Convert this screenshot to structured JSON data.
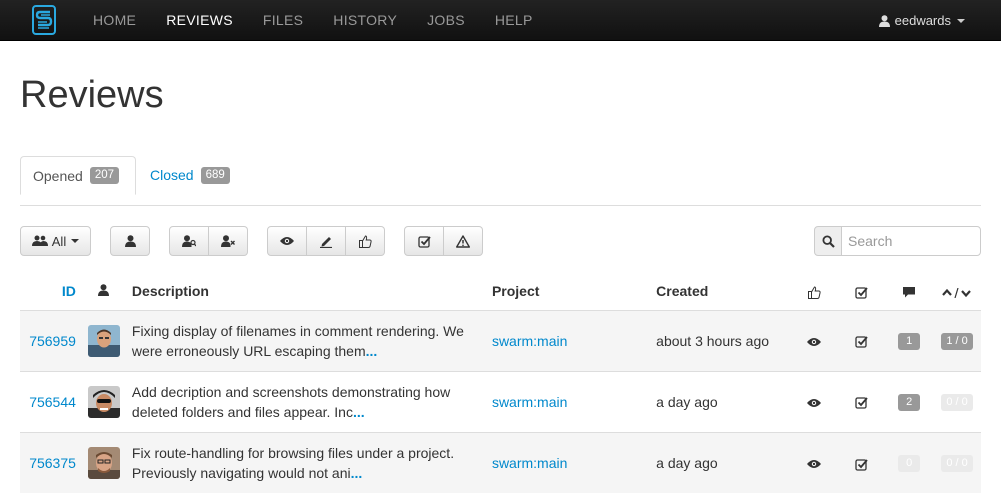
{
  "nav": {
    "logo": "swarm-logo-icon",
    "items": [
      {
        "label": "HOME",
        "active": false
      },
      {
        "label": "REVIEWS",
        "active": true
      },
      {
        "label": "FILES",
        "active": false
      },
      {
        "label": "HISTORY",
        "active": false
      },
      {
        "label": "JOBS",
        "active": false
      },
      {
        "label": "HELP",
        "active": false
      }
    ],
    "user": "eedwards"
  },
  "page": {
    "title": "Reviews"
  },
  "tabs": {
    "opened": {
      "label": "Opened",
      "count": "207"
    },
    "closed": {
      "label": "Closed",
      "count": "689"
    }
  },
  "toolbar": {
    "all_label": "All",
    "search_placeholder": "Search"
  },
  "table": {
    "headers": {
      "id": "ID",
      "description": "Description",
      "project": "Project",
      "created": "Created"
    },
    "rows": [
      {
        "id": "756959",
        "description": "Fixing display of filenames in comment rendering. We were erroneously URL escaping them",
        "more": "...",
        "project": "swarm:main",
        "created": "about 3 hours ago",
        "comments": "1",
        "votes": "1 / 0"
      },
      {
        "id": "756544",
        "description": "Add decription and screenshots demonstrating how deleted folders and files appear. Inc",
        "more": "...",
        "project": "swarm:main",
        "created": "a day ago",
        "comments": "2",
        "votes": "0 / 0"
      },
      {
        "id": "756375",
        "description": "Fix route-handling for browsing files under a project. Previously navigating would not ani",
        "more": "...",
        "project": "swarm:main",
        "created": "a day ago",
        "comments": "0",
        "votes": "0 / 0"
      }
    ]
  },
  "colors": {
    "navbar": "#1b1b1b",
    "link": "#0088cc",
    "badge": "#999999",
    "logo": "#2aa9e0"
  }
}
